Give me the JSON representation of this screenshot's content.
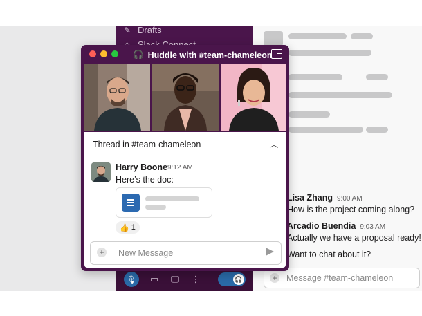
{
  "sidebar": {
    "items": [
      {
        "label": "Drafts",
        "icon": "pencil-icon"
      },
      {
        "label": "Slack Connect",
        "icon": "connect-icon"
      }
    ]
  },
  "huddle": {
    "title": "Huddle with #team-chameleon",
    "colors": {
      "close": "#ff5f57",
      "minimize": "#febc2e",
      "maximize": "#28c840",
      "bg": "#4a154b"
    }
  },
  "thread": {
    "title": "Thread in #team-chameleon",
    "message": {
      "author": "Harry Boone",
      "time": "9:12 AM",
      "text": "Here’s the doc:"
    },
    "reaction": {
      "emoji": "👍",
      "count": "1"
    },
    "composer_placeholder": "New Message"
  },
  "channel": {
    "messages": [
      {
        "author": "Lisa Zhang",
        "time": "9:00 AM",
        "text": "How is the project coming along?"
      },
      {
        "author": "Arcadio Buendia",
        "time": "9:03 AM",
        "text": "Actually we have a proposal ready!"
      },
      {
        "author": "",
        "time": "",
        "text": "Want to chat about it?"
      }
    ],
    "input_placeholder": "Message #team-chameleon"
  }
}
